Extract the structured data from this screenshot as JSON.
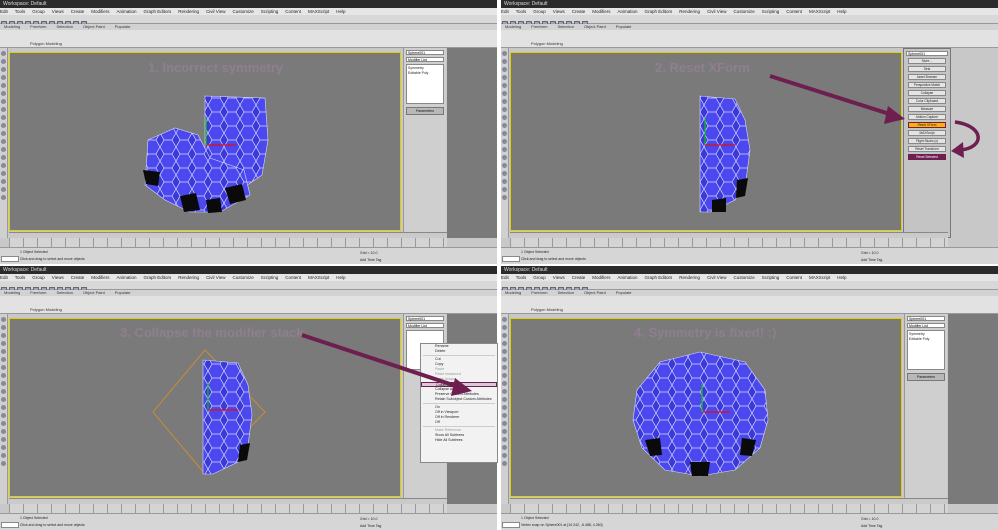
{
  "window": {
    "title": "Workspace: Default"
  },
  "menu": [
    "Edit",
    "Tools",
    "Group",
    "Views",
    "Create",
    "Modifiers",
    "Animation",
    "Graph Editors",
    "Rendering",
    "Civil View",
    "Customize",
    "Scripting",
    "Content",
    "MAXScript",
    "Help"
  ],
  "ribbon": {
    "tabs": [
      "Modeling",
      "Freeform",
      "Selection",
      "Object Paint",
      "Populate"
    ],
    "group_label": "Polygon Modeling"
  },
  "panels": [
    {
      "caption": "1. Incorrect symmetry",
      "object_name": "Sphere001",
      "modifier_list_label": "Modifier List",
      "stack": [
        "Symmetry",
        "Editable Poly"
      ],
      "rollout": "Parameters",
      "status_line1": "1 Object Selected",
      "status_line2": "Click and drag to select and move objects",
      "grid": "Grid = 10.0",
      "add_time_tag": "Add Time Tag"
    },
    {
      "caption": "2. Reset XForm",
      "object_name": "Sphere001",
      "modifier_list_label": "Modifier List",
      "utility_buttons": [
        "More...",
        "Sets",
        "Asset Browser",
        "Perspective Match",
        "Collapse",
        "Color Clipboard",
        "Measure",
        "Motion Capture",
        "Reset XForm",
        "MAXScript",
        "Flight Studio (c)",
        "Reset Transform",
        "Reset Selected"
      ],
      "status_line1": "1 Object Selected",
      "status_line2": "Click and drag to select and move objects",
      "grid": "Grid = 10.0",
      "add_time_tag": "Add Time Tag"
    },
    {
      "caption": "3. Collapse the modifier stack",
      "object_name": "Sphere001",
      "modifier_list_label": "Modifier List",
      "context_menu": [
        "Rename",
        "Delete",
        "Cut",
        "Copy",
        "Paste",
        "Paste Instanced",
        "Make Unique",
        "Collapse To",
        "Collapse All",
        "Preserve Custom Attributes",
        "Retain Subobject Custom Attributes",
        "On",
        "Off in Viewport",
        "Off in Renderer",
        "Off",
        "Make Reference",
        "Show All Subtrees",
        "Hide All Subtrees"
      ],
      "status_line1": "1 Object Selected",
      "status_line2": "Click and drag to select and move objects",
      "grid": "Grid = 10.0",
      "add_time_tag": "Add Time Tag"
    },
    {
      "caption": "4. Symmetry is fixed! :)",
      "object_name": "Sphere001",
      "modifier_list_label": "Modifier List",
      "stack": [
        "Symmetry",
        "Editable Poly"
      ],
      "rollout": "Parameters",
      "status_line1": "1 Object Selected",
      "status_line2": "Vertex snap on Sphere001 at [10.242, -6.488, 4.260]",
      "grid": "Grid = 10.0",
      "add_time_tag": "Add Time Tag"
    }
  ],
  "colors": {
    "annotation": "#6e1f4f",
    "caption": "#8f7f8f",
    "viewport_bg": "#7a7a7a",
    "mesh": "#3a38d8",
    "mesh_edge": "#d8d8ff",
    "highlight": "#ffb000"
  }
}
